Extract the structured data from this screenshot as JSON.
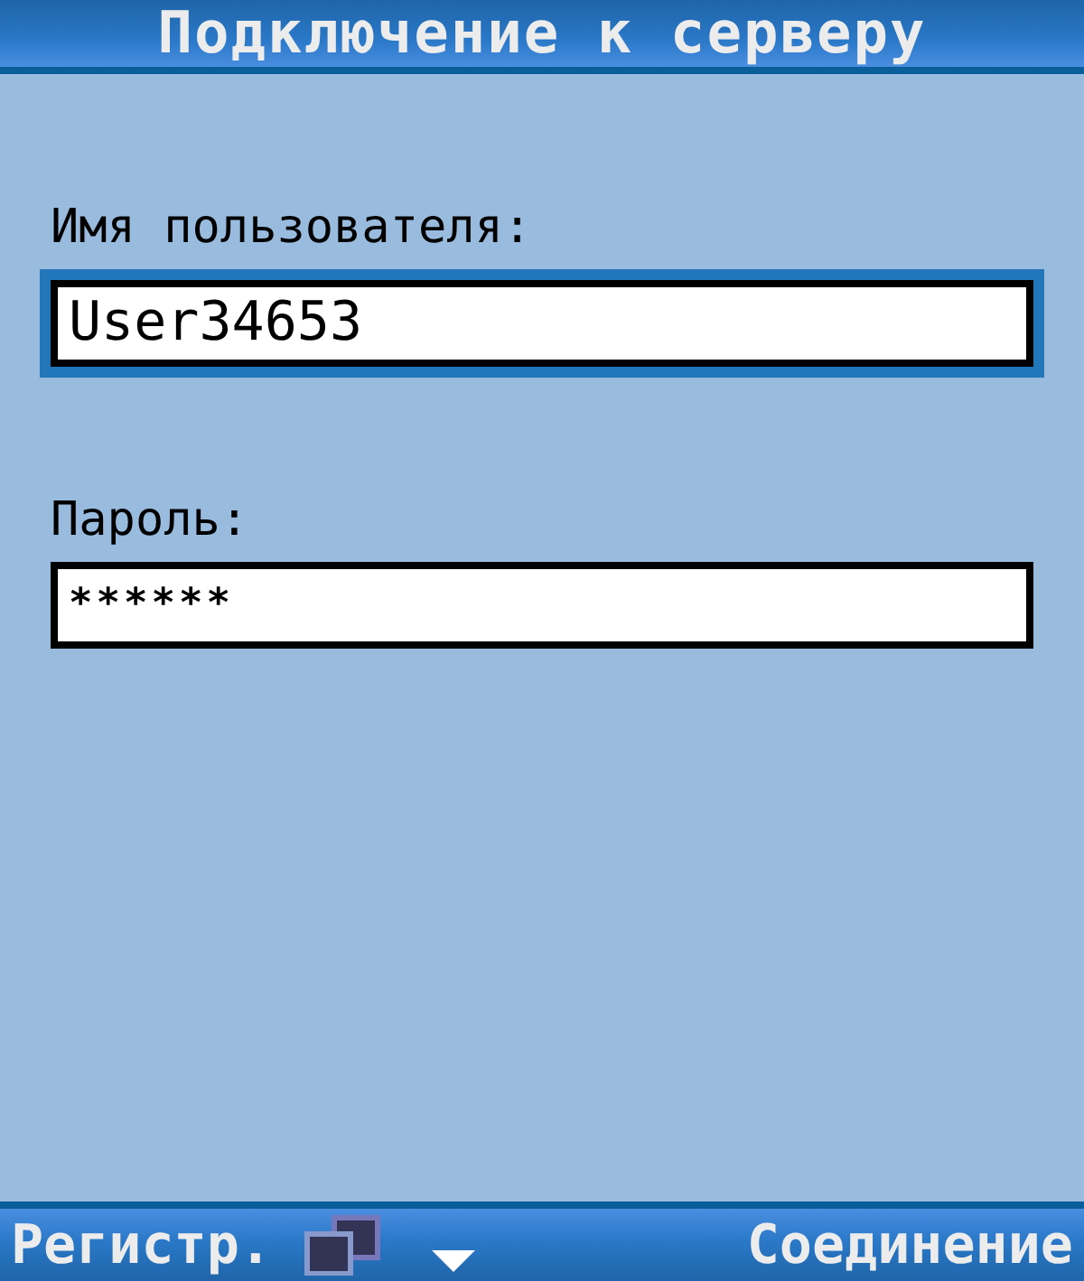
{
  "title": "Подключение к серверу",
  "fields": [
    {
      "label": "Имя пользователя:",
      "value": "User34653",
      "focused": true
    },
    {
      "label": "Пароль:",
      "value": "******",
      "focused": false
    }
  ],
  "softkeys": {
    "left": "Регистр.",
    "right": "Соединение"
  }
}
